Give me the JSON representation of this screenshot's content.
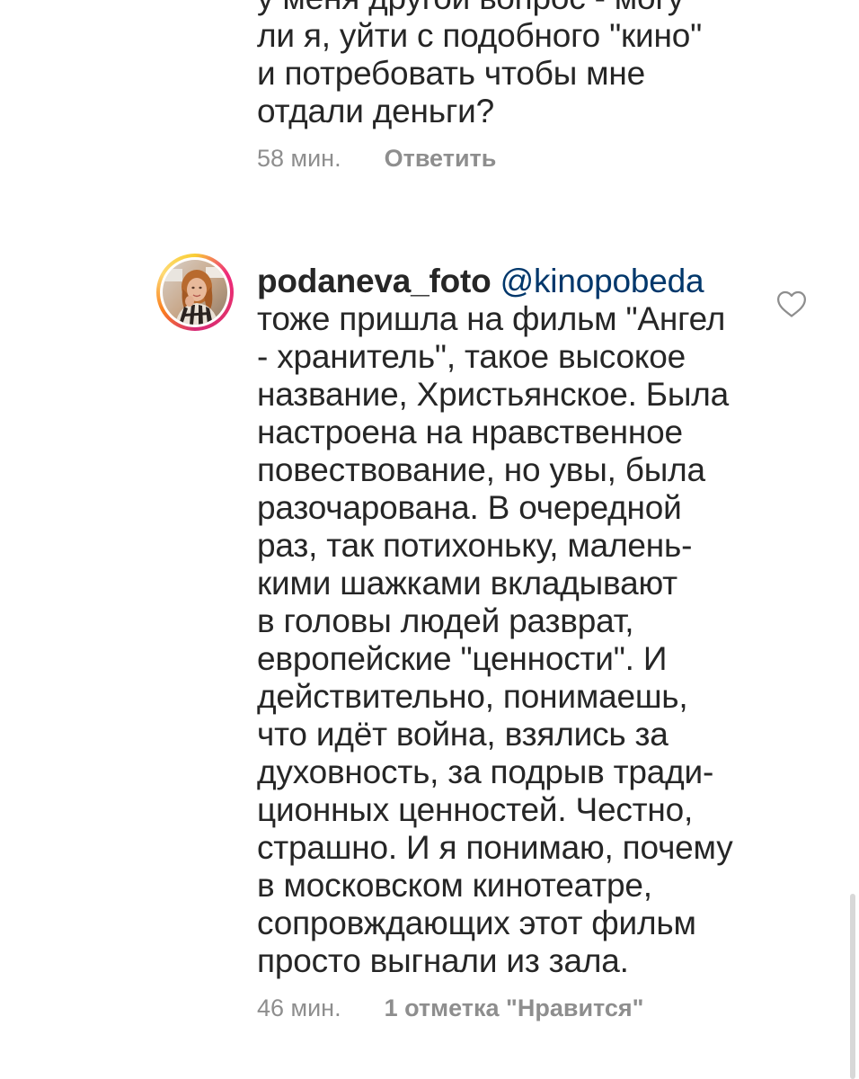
{
  "previous_comment": {
    "lines": [
      "у меня другой вопрос - могу",
      "ли я, уйти с подобного \"кино\"",
      "и потребовать чтобы мне",
      "отдали деньги?"
    ],
    "time": "58 мин.",
    "reply_label": "Ответить"
  },
  "comment": {
    "username": "podaneva_foto",
    "mention": "@kinopobeda",
    "first_line": "тоже пришла на фильм \"Ангел",
    "lines": [
      "- хранитель\", такое высокое",
      "название, Христьянское. Была",
      "настроена на нравственное",
      "повествование, но увы, была",
      "разочарована. В очередной",
      "раз, так потихоньку, малень-",
      "кими шажками вкладывают",
      "в головы людей разврат,",
      "европейские \"ценности\". И",
      "действительно, понимаешь,",
      "что идёт война, взялись за",
      "духовность, за подрыв тради-",
      "ционных ценностей. Честно,",
      "страшно. И я понимаю, почему",
      "в московском кинотеатре,",
      "сопровждающих этот фильм",
      "просто выгнали из зала."
    ],
    "time": "46 мин.",
    "likes_label": "1 отметка \"Нравится\"",
    "like_icon": "heart-outline-icon"
  },
  "colors": {
    "text": "#262626",
    "meta": "#8e8e8e",
    "mention": "#00376b"
  }
}
